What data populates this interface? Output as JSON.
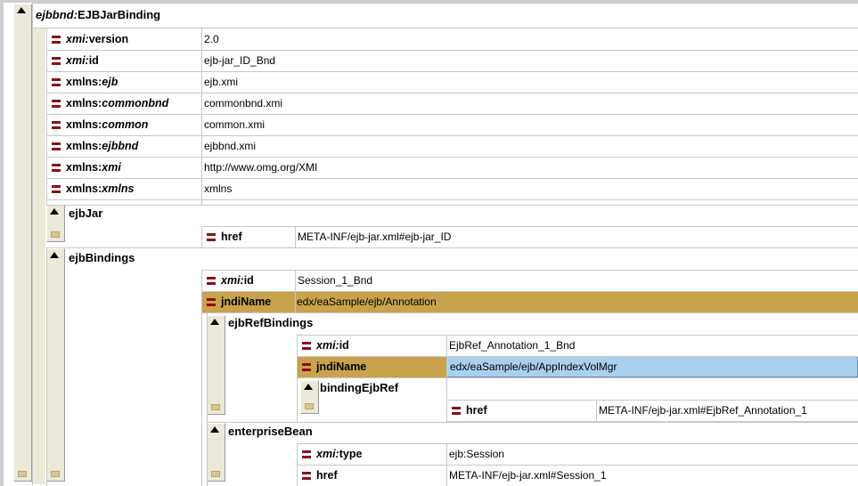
{
  "root": {
    "prefix": "ejbbnd:",
    "name": "EJBJarBinding"
  },
  "root_attrs": [
    {
      "prefix": "xmi:",
      "name": "version",
      "prefix_italic": true,
      "value": "2.0"
    },
    {
      "prefix": "xmi:",
      "name": "id",
      "prefix_italic": true,
      "value": "ejb-jar_ID_Bnd"
    },
    {
      "prefix": "xmlns:",
      "name": "ejb",
      "name_italic": true,
      "value": "ejb.xmi"
    },
    {
      "prefix": "xmlns:",
      "name": "commonbnd",
      "name_italic": true,
      "value": "commonbnd.xmi"
    },
    {
      "prefix": "xmlns:",
      "name": "common",
      "name_italic": true,
      "value": "common.xmi"
    },
    {
      "prefix": "xmlns:",
      "name": "ejbbnd",
      "name_italic": true,
      "value": "ejbbnd.xmi"
    },
    {
      "prefix": "xmlns:",
      "name": "xmi",
      "name_italic": true,
      "value": "http://www.omg.org/XMI"
    },
    {
      "prefix": "xmlns:",
      "name": "xmlns",
      "name_italic": true,
      "value": "xmlns"
    }
  ],
  "ejbJar": {
    "label": "ejbJar",
    "href_label": "href",
    "href_value": "META-INF/ejb-jar.xml#ejb-jar_ID"
  },
  "ejbBindings": {
    "label": "ejbBindings",
    "xmi_id": {
      "prefix": "xmi:",
      "name": "id",
      "value": "Session_1_Bnd"
    },
    "jndiName": {
      "name": "jndiName",
      "value": "edx/eaSample/ejb/Annotation"
    },
    "ejbRefBindings": {
      "label": "ejbRefBindings",
      "xmi_id": {
        "prefix": "xmi:",
        "name": "id",
        "value": "EjbRef_Annotation_1_Bnd"
      },
      "jndiName": {
        "name": "jndiName",
        "value": "edx/eaSample/ejb/AppIndexVolMgr"
      },
      "bindingEjbRef": {
        "label": "bindingEjbRef",
        "href_label": "href",
        "href_value": "META-INF/ejb-jar.xml#EjbRef_Annotation_1"
      }
    },
    "enterpriseBean": {
      "label": "enterpriseBean",
      "xmi_type": {
        "prefix": "xmi:",
        "name": "type",
        "value": "ejb:Session"
      },
      "href_label": "href",
      "href_value": "META-INF/ejb-jar.xml#Session_1"
    }
  }
}
